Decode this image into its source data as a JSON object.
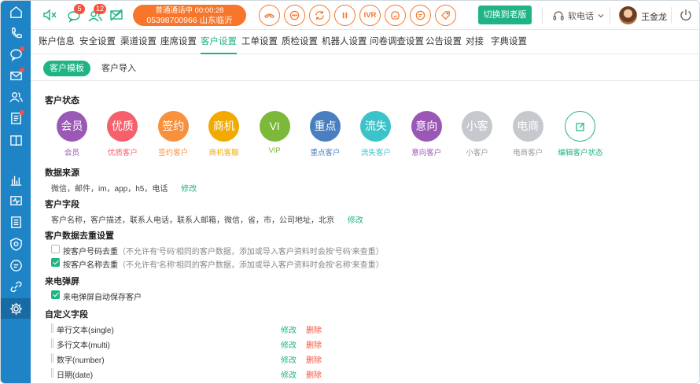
{
  "colors": {
    "sidebar": "#1e84c6",
    "accent": "#1fb386",
    "orange": "#f7762b",
    "danger": "#f5533d"
  },
  "sidebar": {
    "items": [
      {
        "icon": "home-icon"
      },
      {
        "icon": "phone-icon"
      },
      {
        "icon": "chat-icon",
        "dot": true
      },
      {
        "icon": "mail-icon",
        "dot": true
      },
      {
        "icon": "contacts-icon"
      },
      {
        "icon": "ticket-list-icon",
        "dot": true
      },
      {
        "icon": "book-icon"
      },
      {
        "icon": "bar-chart-icon"
      },
      {
        "icon": "monitor-icon"
      },
      {
        "icon": "report-icon"
      },
      {
        "icon": "shield-icon"
      },
      {
        "icon": "message-icon"
      },
      {
        "icon": "link-icon"
      },
      {
        "icon": "gear-icon",
        "active": true
      }
    ]
  },
  "topbar": {
    "mute_icon": "mute-speaker-icon",
    "chat_badge": "5",
    "contacts_badge": "12",
    "mail_icon": "mail-off-icon",
    "call_status_line1": "普通通话中 00:00:28",
    "call_status_line2": "05398700966 山东临沂",
    "controls": [
      {
        "name": "hangup-button",
        "icon": "hangup-icon"
      },
      {
        "name": "consult-button",
        "icon": "dots-chat-icon"
      },
      {
        "name": "transfer-button",
        "icon": "refresh-icon"
      },
      {
        "name": "hold-button",
        "icon": "pause-icon"
      },
      {
        "name": "ivr-button",
        "label": "IVR"
      },
      {
        "name": "satisfaction-button",
        "icon": "face-icon"
      },
      {
        "name": "sms-button",
        "icon": "sms-icon"
      },
      {
        "name": "tag-button",
        "icon": "tag-icon"
      }
    ],
    "switch_label": "切换到老版",
    "softphone_label": "软电话",
    "username": "王金龙"
  },
  "nav": {
    "items": [
      "账户信息",
      "安全设置",
      "渠道设置",
      "座席设置",
      "客户设置",
      "工单设置",
      "质检设置",
      "机器人设置",
      "问卷调查设置",
      "公告设置",
      "对接",
      "字典设置"
    ],
    "active_index": 4
  },
  "subtabs": {
    "items": [
      "客户模板",
      "客户导入"
    ],
    "active_index": 0
  },
  "customer_status": {
    "title": "客户状态",
    "items": [
      {
        "text": "会员",
        "label": "会员",
        "color": "#9b59b6"
      },
      {
        "text": "优质",
        "label": "优质客户",
        "color": "#f4606c"
      },
      {
        "text": "签约",
        "label": "签约客户",
        "color": "#f7913d"
      },
      {
        "text": "商机",
        "label": "商机客服",
        "color": "#f2a900"
      },
      {
        "text": "VI",
        "label": "VIP",
        "color": "#7cb83a"
      },
      {
        "text": "重点",
        "label": "重点客户",
        "color": "#4a7fbf"
      },
      {
        "text": "流失",
        "label": "流失客户",
        "color": "#3cc3c9"
      },
      {
        "text": "意向",
        "label": "意向客户",
        "color": "#9b57b6"
      },
      {
        "text": "小客",
        "label": "小客户",
        "color": "#c5c9ce"
      },
      {
        "text": "电商",
        "label": "电商客户",
        "color": "#c5c9ce"
      }
    ],
    "edit_label": "编辑客户状态"
  },
  "data_source": {
    "title": "数据来源",
    "value": "微信，邮件，im，app，h5，电话",
    "edit": "修改"
  },
  "customer_fields": {
    "title": "客户字段",
    "value": "客户名称，客户描述，联系人电话，联系人邮箱，微信，省，市，公司地址，北京",
    "edit": "修改"
  },
  "dedup": {
    "title": "客户数据去重设置",
    "options": [
      {
        "label": "按客户号码去重",
        "hint": "（不允许有'号码'相同的客户数据，添加或导入客户资料时会按'号码'来查重）",
        "checked": false
      },
      {
        "label": "按客户名称去重",
        "hint": "（不允许有'名称'相同的客户数据，添加或导入客户资料时会按'名称'来查重）",
        "checked": true
      }
    ]
  },
  "popup": {
    "title": "来电弹屏",
    "option": {
      "label": "来电弹屏自动保存客户",
      "checked": true
    }
  },
  "custom_fields": {
    "title": "自定义字段",
    "edit": "修改",
    "delete": "删除",
    "items": [
      "单行文本(single)",
      "多行文本(multi)",
      "数字(number)",
      "日期(date)"
    ]
  }
}
